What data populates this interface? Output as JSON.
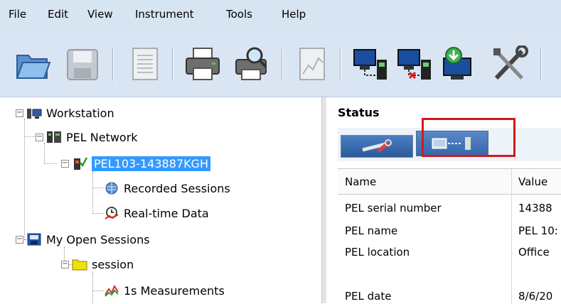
{
  "menu": {
    "items": [
      "File",
      "Edit",
      "View",
      "Instrument",
      "Tools",
      "Help"
    ]
  },
  "toolbar": {
    "buttons": [
      {
        "icon": "open-folder-icon"
      },
      {
        "icon": "save-disk-icon"
      },
      {
        "icon": "report-icon"
      },
      {
        "icon": "print-icon"
      },
      {
        "icon": "print-preview-icon"
      },
      {
        "icon": "chart-document-icon"
      },
      {
        "icon": "connect-instrument-icon"
      },
      {
        "icon": "disconnect-instrument-icon"
      },
      {
        "icon": "download-icon"
      },
      {
        "icon": "tools-icon"
      }
    ]
  },
  "tree": {
    "workstation": "Workstation",
    "pel_network": "PEL Network",
    "device": "PEL103-143887KGH",
    "recorded_sessions": "Recorded Sessions",
    "realtime_data": "Real-time Data",
    "my_open_sessions": "My Open Sessions",
    "session": "session",
    "measurements": "1s Measurements"
  },
  "status": {
    "title": "Status",
    "columns": {
      "name": "Name",
      "value": "Value"
    },
    "rows": [
      {
        "name": "PEL serial number",
        "value": "14388"
      },
      {
        "name": "PEL name",
        "value": "PEL 10:"
      },
      {
        "name": "PEL location",
        "value": "Office"
      },
      {
        "name": "",
        "value": ""
      },
      {
        "name": "PEL date",
        "value": "8/6/20"
      }
    ]
  },
  "colors": {
    "menubar": "#d7e4f2",
    "selection": "#3399ff",
    "highlight": "#d01b1b"
  }
}
